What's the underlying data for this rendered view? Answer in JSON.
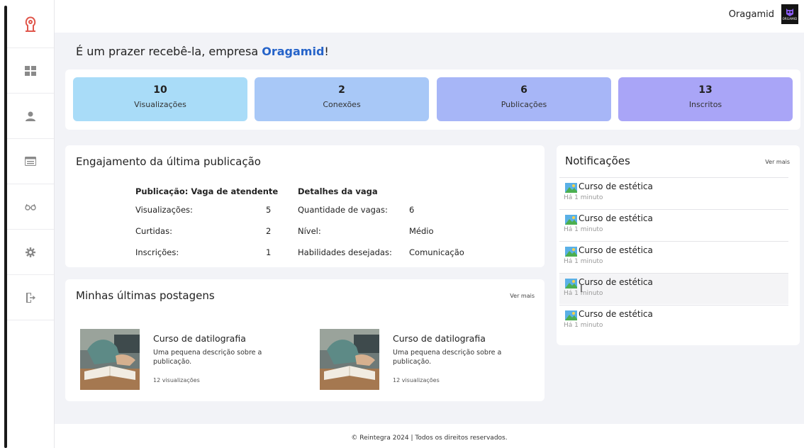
{
  "header": {
    "user_name": "Oragamid",
    "avatar_text": "ORGAMID"
  },
  "sidebar": {
    "items": [
      {
        "icon": "logo-icon"
      },
      {
        "icon": "dashboard-icon"
      },
      {
        "icon": "user-icon"
      },
      {
        "icon": "browser-window-icon"
      },
      {
        "icon": "glasses-icon"
      },
      {
        "icon": "gear-icon"
      },
      {
        "icon": "logout-icon"
      }
    ]
  },
  "welcome": {
    "prefix": "É um prazer recebê-la, empresa ",
    "company": "Oragamid",
    "suffix": "!"
  },
  "stats": [
    {
      "value": "10",
      "label": "Visualizações",
      "color": "#a9dcf8"
    },
    {
      "value": "2",
      "label": "Conexões",
      "color": "#a8c8f7"
    },
    {
      "value": "6",
      "label": "Publicações",
      "color": "#a7b6f7"
    },
    {
      "value": "13",
      "label": "Inscritos",
      "color": "#a9a5f7"
    }
  ],
  "engagement": {
    "title": "Engajamento da última publicação",
    "post_heading": "Publicação: Vaga de atendente",
    "metrics": [
      {
        "label": "Visualizações:",
        "value": "5"
      },
      {
        "label": "Curtidas:",
        "value": "2"
      },
      {
        "label": "Inscrições:",
        "value": "1"
      }
    ],
    "details_heading": "Detalhes da vaga",
    "details": [
      {
        "label": "Quantidade de vagas:",
        "value": "6"
      },
      {
        "label": "Nível:",
        "value": "Médio"
      },
      {
        "label": "Habilidades desejadas:",
        "value": "Comunicação"
      }
    ]
  },
  "posts": {
    "title": "Minhas últimas postagens",
    "see_more": "Ver mais",
    "items": [
      {
        "title": "Curso de datilografia",
        "description": "Uma pequena descrição sobre a publicação.",
        "views": "12 visualizações"
      },
      {
        "title": "Curso de datilografia",
        "description": "Uma pequena descrição sobre a publicação.",
        "views": "12 visualizações"
      }
    ]
  },
  "notifications": {
    "title": "Notificações",
    "see_more": "Ver mais",
    "items": [
      {
        "title": "Curso de estética",
        "time": "Há 1 minuto"
      },
      {
        "title": "Curso de estética",
        "time": "Há 1 minuto"
      },
      {
        "title": "Curso de estética",
        "time": "Há 1 minuto"
      },
      {
        "title": "Curso de estética",
        "time": "Há 1 minuto"
      },
      {
        "title": "Curso de estética",
        "time": "Há 1 minuto"
      }
    ]
  },
  "footer": {
    "text": "© Reintegra 2024 | Todos os direitos reservados."
  },
  "colors": {
    "accent": "#e0564b",
    "brand_blue": "#2563c9"
  }
}
